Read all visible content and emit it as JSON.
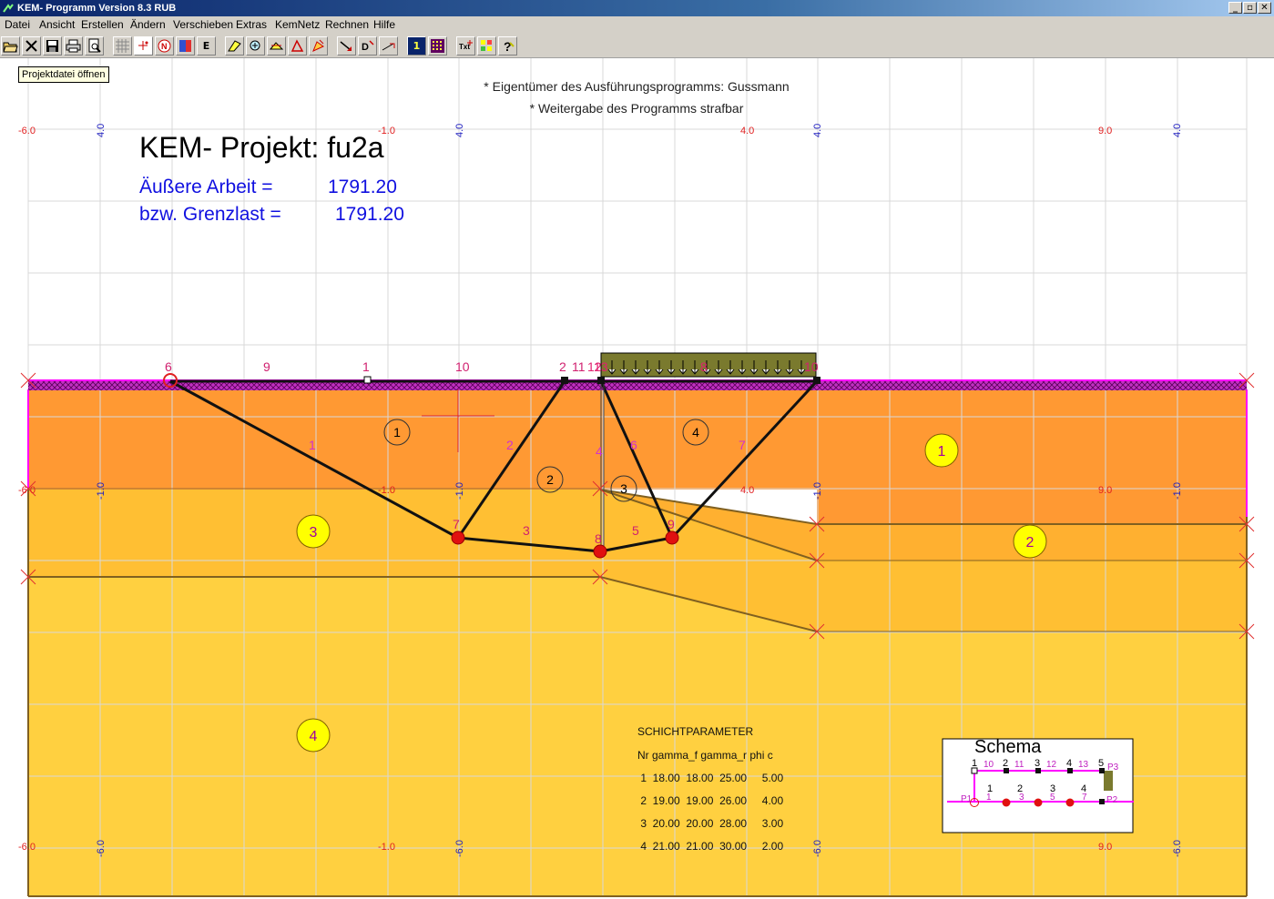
{
  "window": {
    "title": "KEM- Programm Version 8.3 RUB",
    "min": "_",
    "restore": "▫",
    "close": "✕"
  },
  "menu": [
    "Datei",
    "Ansicht",
    "Erstellen",
    "Ändern",
    "Verschieben",
    "Extras",
    "KemNetz",
    "Rechnen",
    "Hilfe"
  ],
  "toolbar": {
    "e_label": "E",
    "one_label": "1",
    "tooltip": "Projektdatei öffnen"
  },
  "notice": {
    "line1": "* Eigentümer des Ausführungsprogramms: Gussmann",
    "line2": "* Weitergabe des Programms strafbar"
  },
  "project": {
    "title": "KEM- Projekt: fu2a",
    "work_label": "Äußere Arbeit =",
    "work_value": "1791.20",
    "limit_label": "bzw. Grenzlast =",
    "limit_value": "1791.20"
  },
  "axis_labels": {
    "x_top": [
      "-6.0",
      "-1.0",
      "4.0",
      "9.0"
    ],
    "x_mid": [
      "-6.0",
      "-1.0",
      "4.0",
      "9.0"
    ],
    "x_bot": [
      "-6.0",
      "-1.0",
      "9.0"
    ],
    "y_top": [
      "4.0",
      "4.0",
      "4.0",
      "4.0"
    ],
    "y_mid": [
      "-1.0",
      "-1.0",
      "-1.0",
      "-1.0"
    ],
    "y_bot": [
      "-6.0",
      "-6.0",
      "-6.0",
      "-6.0"
    ]
  },
  "node_labels": [
    "6",
    "9",
    "1",
    "10",
    "2",
    "11",
    "12",
    "13",
    "8",
    "10",
    "7",
    "8",
    "9",
    "3",
    "5"
  ],
  "bar_labels": [
    "1",
    "2",
    "4",
    "6",
    "7",
    "3",
    "5"
  ],
  "block_labels": [
    "1",
    "2",
    "3",
    "4"
  ],
  "layer_labels": [
    "1",
    "2",
    "3",
    "4"
  ],
  "layer_colors": {
    "1": "#ff9933",
    "2": "#ffb030",
    "3": "#ffbf33",
    "4": "#ffd040"
  },
  "table": {
    "title": "SCHICHTPARAMETER",
    "header": "Nr gamma_f gamma_r phi c",
    "rows": [
      " 1  18.00  18.00  25.00     5.00",
      " 2  19.00  19.00  26.00     4.00",
      " 3  20.00  20.00  28.00     3.00",
      " 4  21.00  21.00  30.00     2.00"
    ]
  },
  "schema": {
    "title": "Schema",
    "top_nodes": [
      "1",
      "2",
      "3",
      "4",
      "5"
    ],
    "top_bars": [
      "10",
      "11",
      "12",
      "13"
    ],
    "mid": [
      "1",
      "2",
      "3",
      "4"
    ],
    "bottom": [
      "1",
      "3",
      "5",
      "7"
    ],
    "p_labels": [
      "P1",
      "P2",
      "P3"
    ]
  }
}
